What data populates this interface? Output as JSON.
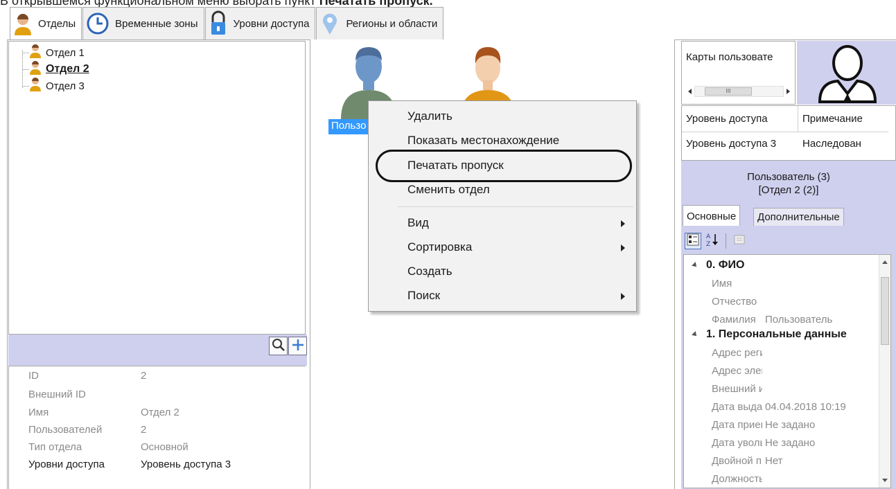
{
  "caption": {
    "prefix": "В открывшемся функциональном меню выбрать пункт ",
    "highlight": "Печатать пропуск."
  },
  "tabs": [
    {
      "label": "Отделы",
      "icon": "user-icon",
      "active": true
    },
    {
      "label": "Временные зоны",
      "icon": "clock-icon",
      "active": false
    },
    {
      "label": "Уровни доступа",
      "icon": "lock-icon",
      "active": false
    },
    {
      "label": "Регионы и области",
      "icon": "map-pin-icon",
      "active": false
    }
  ],
  "tree": {
    "items": [
      {
        "label": "Отдел 1",
        "selected": false
      },
      {
        "label": "Отдел 2",
        "selected": true
      },
      {
        "label": "Отдел 3",
        "selected": false
      }
    ]
  },
  "department_props": {
    "rows": [
      {
        "key": "ID",
        "value": "2"
      },
      {
        "key": "Внешний ID",
        "value": ""
      },
      {
        "key": "Имя",
        "value": "Отдел 2"
      },
      {
        "key": "Пользователей",
        "value": "2"
      },
      {
        "key": "Тип отдела",
        "value": "Основной"
      },
      {
        "key": "Уровни доступа",
        "value": "Уровень доступа 3"
      }
    ]
  },
  "users": {
    "selected_label": "Пользо"
  },
  "context_menu": {
    "items": [
      {
        "label": "Удалить",
        "submenu": false
      },
      {
        "label": "Показать местонахождение",
        "submenu": false
      },
      {
        "label": "Печатать пропуск",
        "submenu": false,
        "highlighted": true
      },
      {
        "label": "Сменить отдел",
        "submenu": false
      },
      {
        "label": "Вид",
        "submenu": true
      },
      {
        "label": "Сортировка",
        "submenu": true
      },
      {
        "label": "Создать",
        "submenu": false
      },
      {
        "label": "Поиск",
        "submenu": true
      }
    ]
  },
  "cards": {
    "title": "Карты пользовате",
    "scroll_thumb": "III"
  },
  "access_table": {
    "headers": [
      "Уровень доступа",
      "Примечание"
    ],
    "rows": [
      [
        "Уровень доступа 3",
        "Наследован"
      ]
    ]
  },
  "user_info": {
    "line1": "Пользователь (3)",
    "line2": "[Отдел 2 (2)]"
  },
  "sub_tabs": [
    {
      "label": "Основные",
      "active": true
    },
    {
      "label": "Дополнительные",
      "active": false
    }
  ],
  "property_grid": {
    "categories": [
      {
        "label": "0. ФИО",
        "rows": [
          {
            "key": "Имя",
            "value": ""
          },
          {
            "key": "Отчество",
            "value": ""
          },
          {
            "key": "Фамилия",
            "value": "Пользователь"
          }
        ]
      },
      {
        "label": "1. Персональные данные",
        "rows": [
          {
            "key": "Адрес регис",
            "value": ""
          },
          {
            "key": "Адрес элект",
            "value": ""
          },
          {
            "key": "Внешний ид",
            "value": ""
          },
          {
            "key": "Дата выдач",
            "value": "04.04.2018 10:19"
          },
          {
            "key": "Дата прием",
            "value": "Не задано"
          },
          {
            "key": "Дата уволь",
            "value": "Не задано"
          },
          {
            "key": "Двойной пр",
            "value": "Нет"
          },
          {
            "key": "Должность",
            "value": ""
          }
        ]
      }
    ]
  },
  "colors": {
    "panel_band": "#cfcfee",
    "selection": "#3399ff",
    "menu_bg": "#f2f2f2"
  }
}
